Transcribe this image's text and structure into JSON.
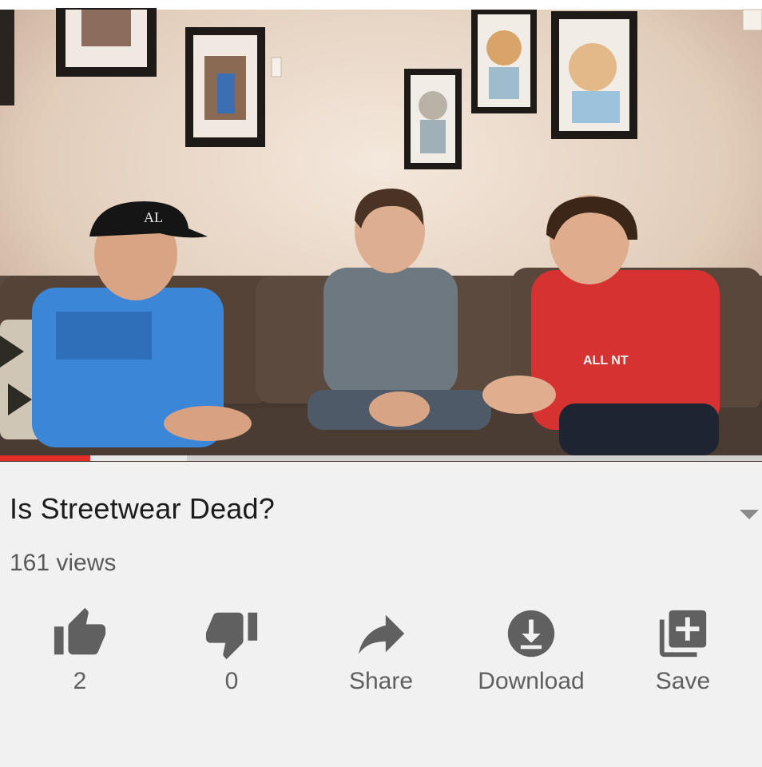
{
  "video": {
    "progress_fraction": 0.118,
    "buffer_fraction": 0.245,
    "cap_text": "AL",
    "shirt_text": "ALL NT"
  },
  "info": {
    "title": "Is Streetwear Dead?",
    "views": "161 views"
  },
  "actions": {
    "like_count": "2",
    "dislike_count": "0",
    "share_label": "Share",
    "download_label": "Download",
    "save_label": "Save"
  },
  "colors": {
    "progress": "#e52d27",
    "icon": "#606060",
    "title": "#1c1c1c"
  },
  "icons": {
    "like": "thumb-up-icon",
    "dislike": "thumb-down-icon",
    "share": "share-arrow-icon",
    "download": "download-circle-icon",
    "save": "playlist-add-icon",
    "expand": "chevron-down-icon"
  }
}
